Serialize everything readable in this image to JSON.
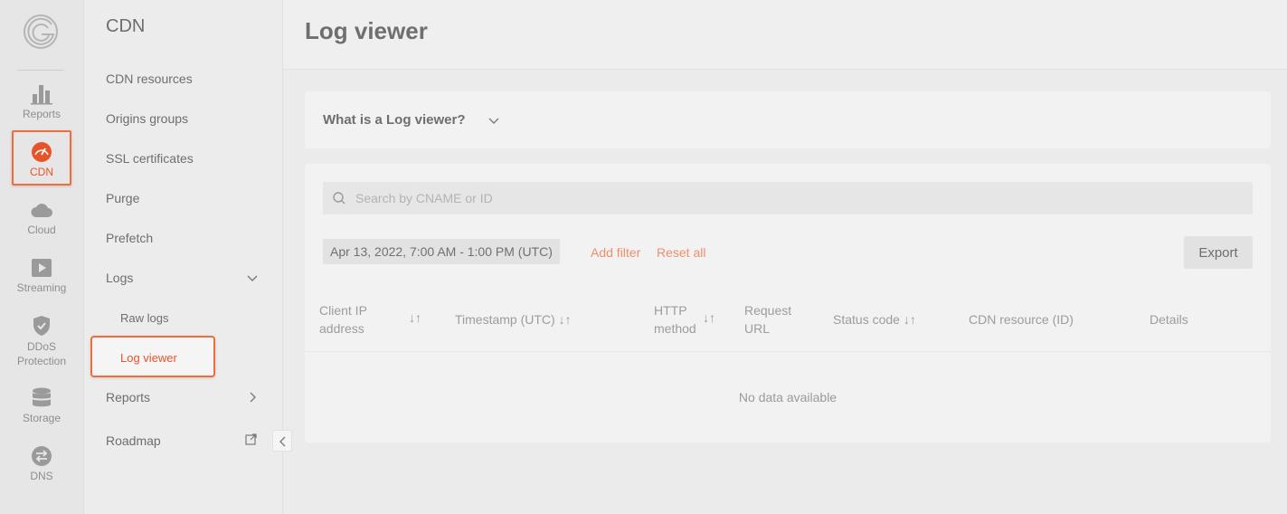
{
  "rail": {
    "items": [
      {
        "label": "Reports",
        "icon": "bar-chart-icon"
      },
      {
        "label": "CDN",
        "icon": "speedometer-icon",
        "active": true
      },
      {
        "label": "Cloud",
        "icon": "cloud-icon"
      },
      {
        "label": "Streaming",
        "icon": "play-icon"
      },
      {
        "label": "DDoS Protection",
        "icon": "shield-icon"
      },
      {
        "label": "Storage",
        "icon": "database-icon"
      },
      {
        "label": "DNS",
        "icon": "swap-icon"
      }
    ]
  },
  "subnav": {
    "title": "CDN",
    "items": [
      {
        "label": "CDN resources"
      },
      {
        "label": "Origins groups"
      },
      {
        "label": "SSL certificates"
      },
      {
        "label": "Purge"
      },
      {
        "label": "Prefetch"
      },
      {
        "label": "Logs"
      },
      {
        "label": "Raw logs"
      },
      {
        "label": "Log viewer",
        "active": true
      },
      {
        "label": "Reports"
      },
      {
        "label": "Roadmap"
      }
    ]
  },
  "page": {
    "title": "Log viewer",
    "faq_label": "What is a Log viewer?"
  },
  "search": {
    "placeholder": "Search by CNAME or ID"
  },
  "filters": {
    "date_range": "Apr 13, 2022, 7:00 AM - 1:00 PM (UTC)",
    "add_filter": "Add filter",
    "reset_all": "Reset all",
    "export": "Export"
  },
  "table": {
    "columns": {
      "client_ip_1": "Client IP",
      "client_ip_2": "address",
      "timestamp": "Timestamp (UTC)",
      "http_1": "HTTP",
      "http_2": "method",
      "url_1": "Request",
      "url_2": "URL",
      "status": "Status code",
      "resource": "CDN resource (ID)",
      "details": "Details"
    },
    "sort_glyph": "↓↑",
    "empty_text": "No data available"
  },
  "colors": {
    "accent": "#e8542a",
    "highlight_border": "#f06c3c",
    "link": "#f08e6c"
  }
}
